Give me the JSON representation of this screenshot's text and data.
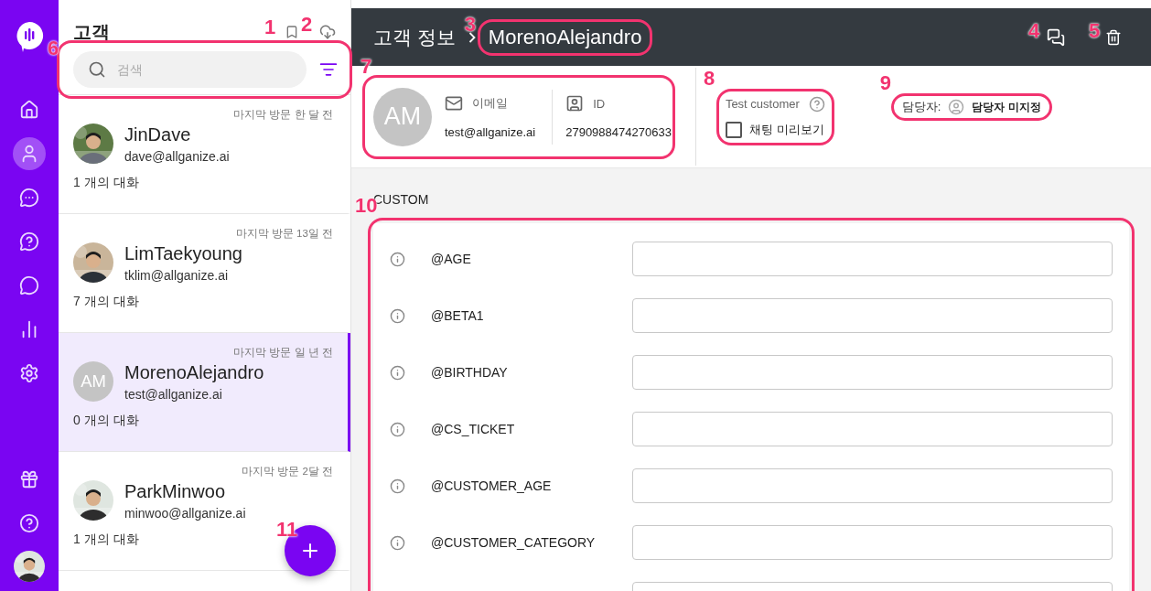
{
  "nav": {
    "items": [
      {
        "selected": false
      },
      {
        "selected": true
      },
      {
        "selected": false
      },
      {
        "selected": false
      },
      {
        "selected": false
      },
      {
        "selected": false
      },
      {
        "selected": false
      }
    ],
    "bottom_items": [
      {
        "selected": false
      },
      {
        "selected": false
      }
    ]
  },
  "customer_list": {
    "title": "고객",
    "bookmark_callout": "1",
    "download_callout": "2",
    "search": {
      "placeholder": "검색",
      "callout": "6"
    },
    "customers": [
      {
        "name": "JinDave",
        "email": "dave@allganize.ai",
        "last_visit": "마지막 방문 한 달 전",
        "conversations": "1 개의 대화",
        "selected": false
      },
      {
        "name": "LimTaekyoung",
        "email": "tklim@allganize.ai",
        "last_visit": "마지막 방문 13일 전",
        "conversations": "7 개의 대화",
        "selected": false
      },
      {
        "name": "MorenoAlejandro",
        "email": "test@allganize.ai",
        "last_visit": "마지막 방문 일 년 전",
        "conversations": "0 개의 대화",
        "avatar": {
          "kind": "initials",
          "initials": "AM"
        },
        "selected": true
      },
      {
        "name": "ParkMinwoo",
        "email": "minwoo@allganize.ai",
        "last_visit": "마지막 방문 2달 전",
        "conversations": "1 개의 대화",
        "selected": false
      }
    ],
    "add_callout": "11"
  },
  "customer_info": {
    "title": "고객 정보",
    "name": "MorenoAlejandro",
    "name_callout": "3",
    "chat_callout": "4",
    "delete_callout": "5",
    "profile": {
      "initials": "AM",
      "email_label": "이메일",
      "email": "test@allganize.ai",
      "id_label": "ID",
      "id": "2790988474270633",
      "callout": "7"
    },
    "test_customer": {
      "label": "Test customer",
      "checkbox_label": "채팅 미리보기",
      "checked": false,
      "callout": "8"
    },
    "assignee": {
      "label": "담당자:",
      "value": "담당자 미지정",
      "callout": "9"
    },
    "custom": {
      "title": "CUSTOM",
      "callout": "10",
      "fields": [
        {
          "label": "@AGE"
        },
        {
          "label": "@BETA1"
        },
        {
          "label": "@BIRTHDAY"
        },
        {
          "label": "@CS_TICKET"
        },
        {
          "label": "@CUSTOMER_AGE"
        },
        {
          "label": "@CUSTOMER_CATEGORY"
        }
      ]
    }
  }
}
